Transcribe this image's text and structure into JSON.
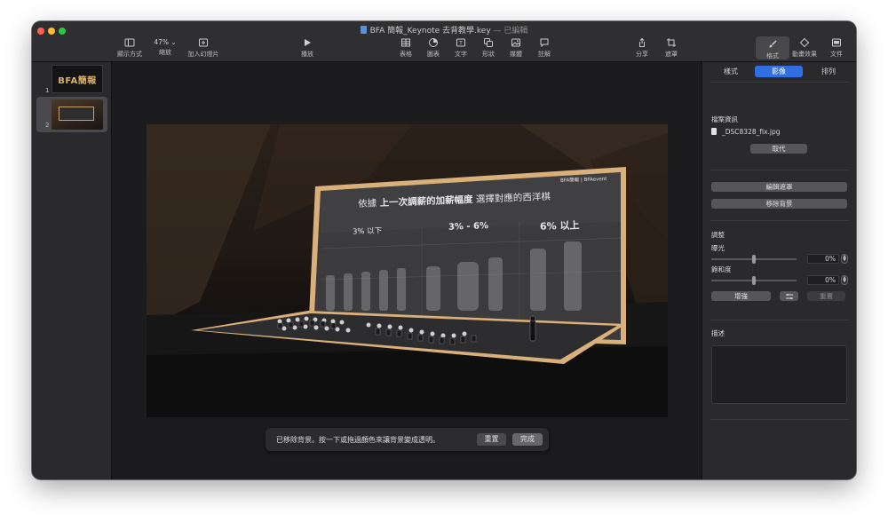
{
  "window": {
    "title": "BFA 簡報_Keynote 去背教學.key",
    "status": "— 已編輯"
  },
  "toolbar": {
    "view_label": "顯示方式",
    "zoom_value": "47%",
    "zoom_label": "縮放",
    "add_slide_label": "加入幻燈片",
    "play_label": "播放",
    "table_label": "表格",
    "chart_label": "圖表",
    "text_label": "文字",
    "shape_label": "形狀",
    "media_label": "媒體",
    "comment_label": "註解",
    "share_label": "分享",
    "mask_label": "遮罩",
    "format_label": "格式",
    "animate_label": "動畫效果",
    "document_label": "文件"
  },
  "slides": [
    {
      "number": "1",
      "thumb_text": "BFA簡報"
    },
    {
      "number": "2"
    }
  ],
  "photo_sign": {
    "headline_pre": "依據",
    "headline_bold": "上一次調薪的加薪幅度",
    "headline_post": "選擇對應的西洋棋",
    "col1": "3% 以下",
    "col2": "3% - 6%",
    "col3": "6% 以上",
    "logo": "BFA簡報 | BFAevent"
  },
  "banner": {
    "message": "已移除背景。按一下或拖過顏色來讓背景變成透明。",
    "reset_label": "重置",
    "done_label": "完成"
  },
  "inspector": {
    "tabs": [
      "樣式",
      "影像",
      "排列"
    ],
    "selected_tab": "影像",
    "file_info_title": "檔案資訊",
    "file_name": "_DSC8328_fix.jpg",
    "replace_label": "取代",
    "edit_mask_label": "編輯遮罩",
    "remove_bg_label": "移除背景",
    "adjust_title": "調整",
    "exposure_label": "曝光",
    "exposure_value": "0%",
    "exposure_level": 0.5,
    "saturation_label": "飽和度",
    "saturation_value": "0%",
    "saturation_level": 0.5,
    "enhance_label": "增強",
    "reset_label": "重置",
    "description_title": "描述"
  },
  "colors": {
    "accent": "#2f6fe0",
    "window_bg": "#1e1e20",
    "frame_gold": "#d9b07a"
  }
}
